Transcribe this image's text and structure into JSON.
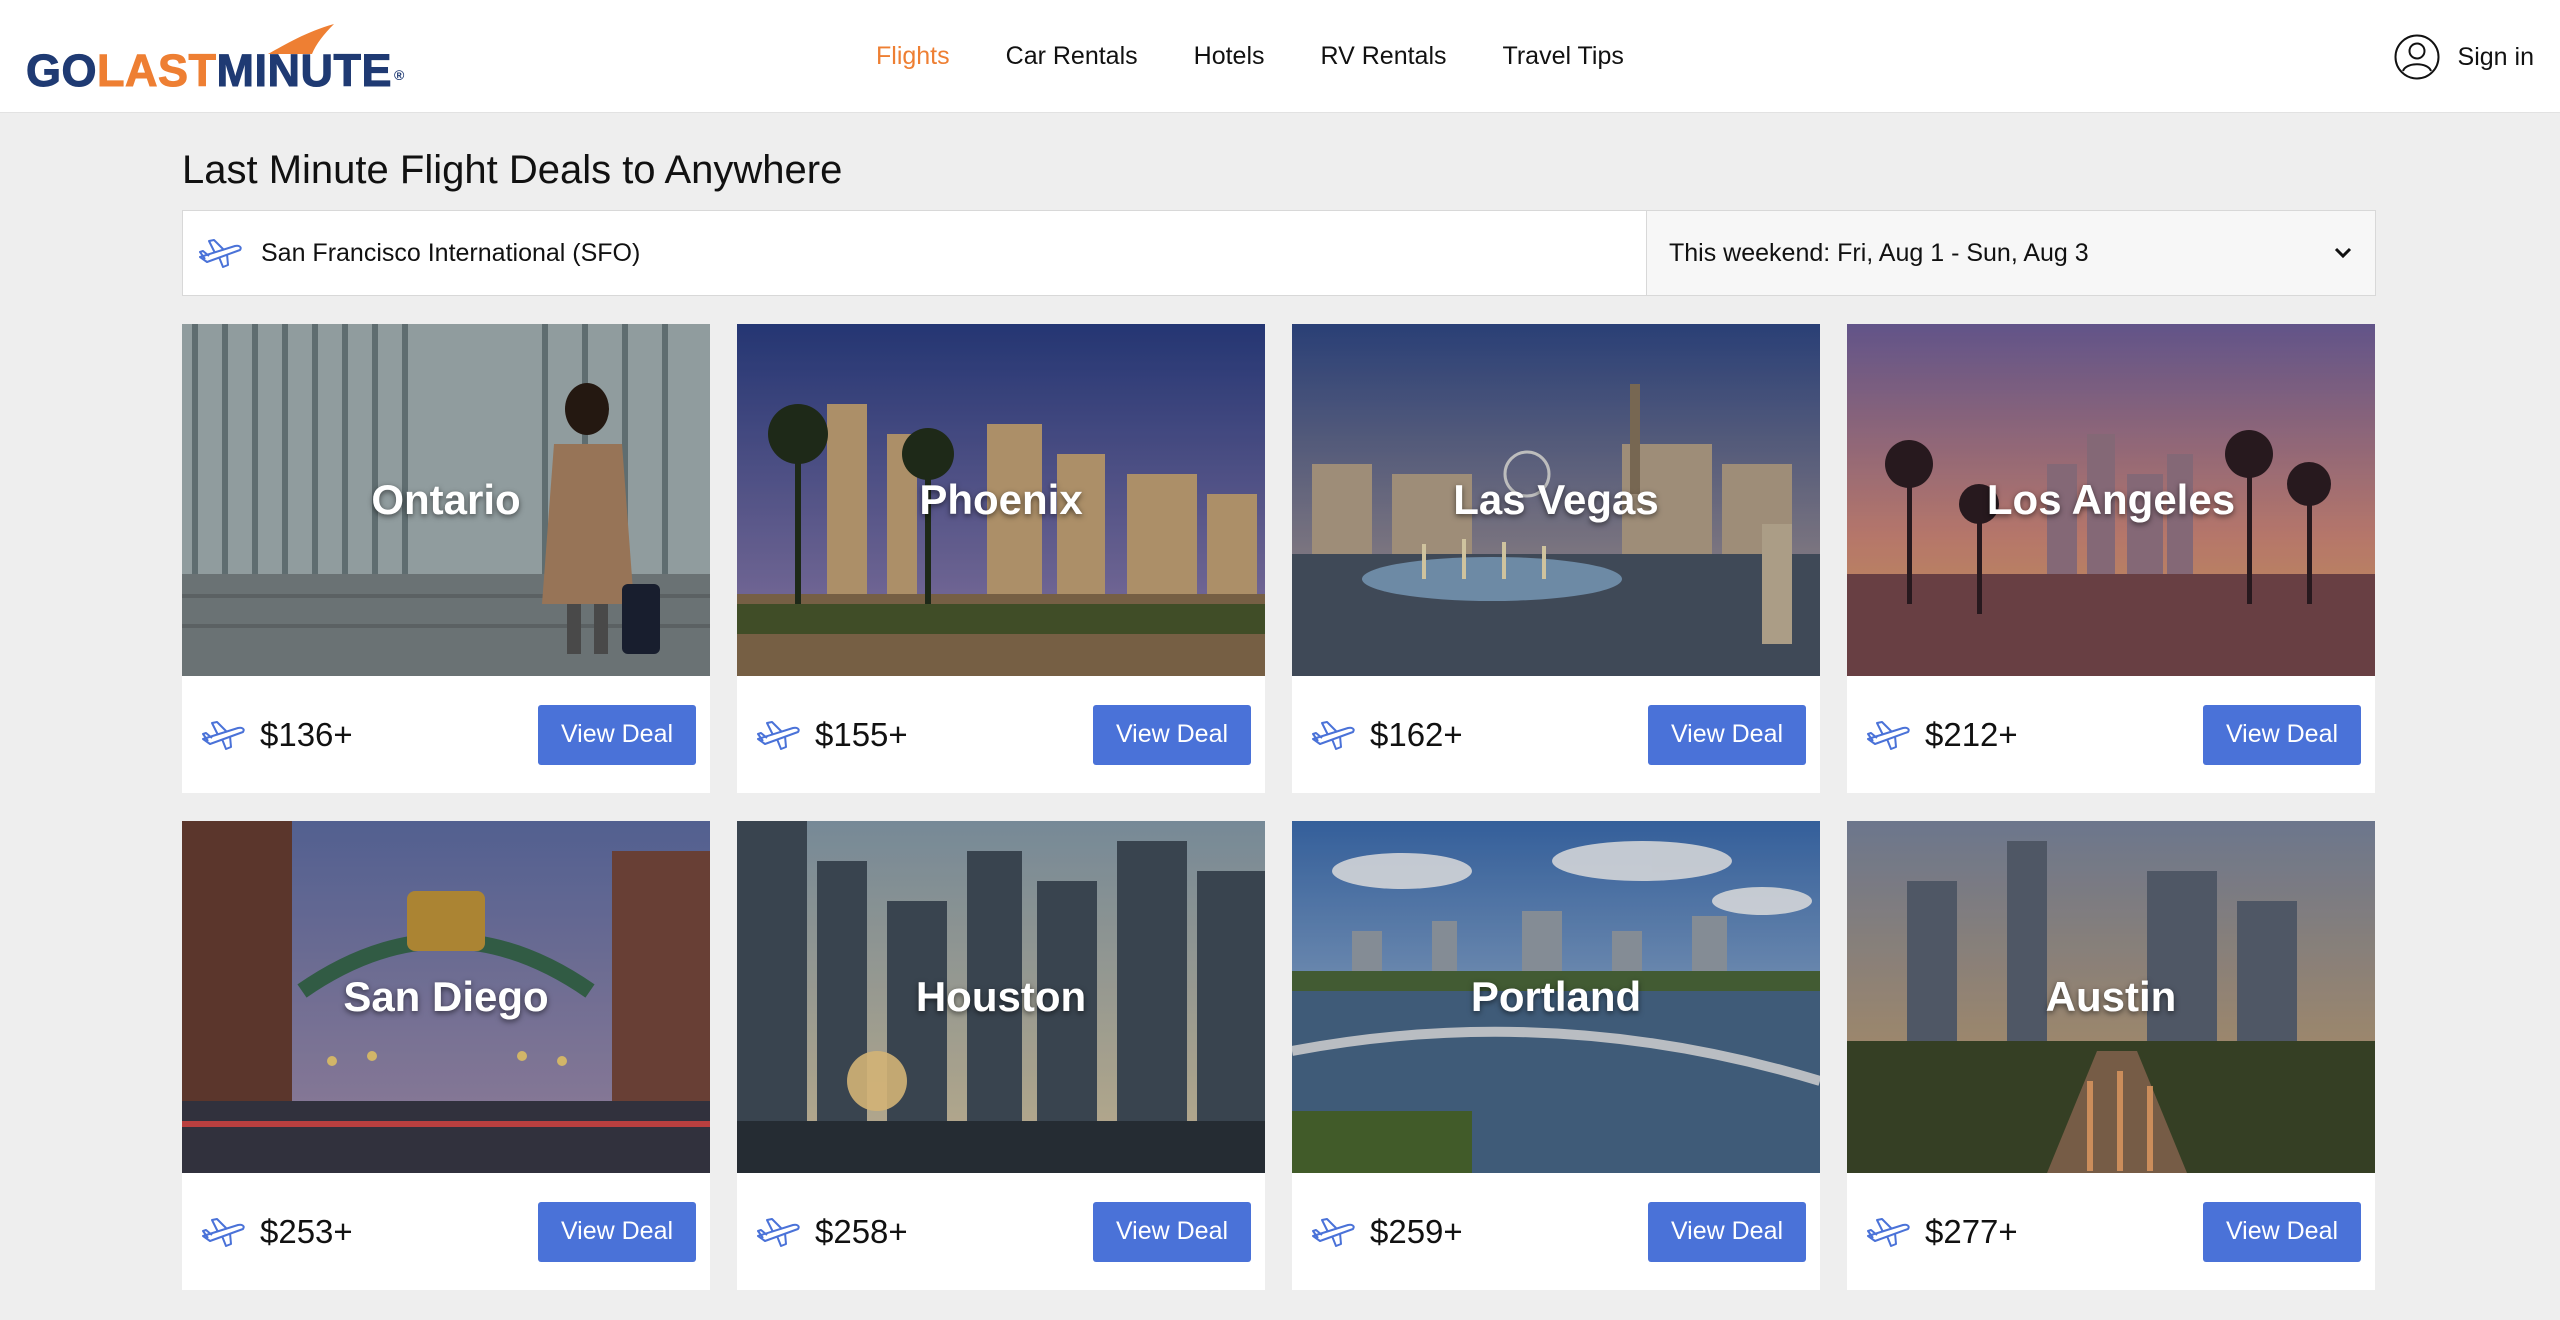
{
  "brand": {
    "logo_go": "GO",
    "logo_last": "LAST",
    "logo_minute": "MINUTE",
    "logo_reg": "®",
    "colors": {
      "navy": "#1f3a73",
      "orange": "#ee7f33"
    }
  },
  "nav": {
    "items": [
      {
        "label": "Flights",
        "active": true
      },
      {
        "label": "Car Rentals",
        "active": false
      },
      {
        "label": "Hotels",
        "active": false
      },
      {
        "label": "RV Rentals",
        "active": false
      },
      {
        "label": "Travel Tips",
        "active": false
      }
    ],
    "signin_label": "Sign in",
    "signin_icon": "user-circle-icon"
  },
  "main": {
    "title": "Last Minute Flight Deals to Anywhere",
    "origin": {
      "icon": "plane-icon",
      "value": "San Francisco International (SFO)"
    },
    "date_range": {
      "selected": "This weekend: Fri, Aug 1 - Sun, Aug 3",
      "icon": "chevron-down-icon"
    }
  },
  "deals": [
    {
      "city": "Ontario",
      "price": "$136+",
      "button": "View Deal",
      "scene": "person-with-luggage"
    },
    {
      "city": "Phoenix",
      "price": "$155+",
      "button": "View Deal",
      "scene": "palm-skyline"
    },
    {
      "city": "Las Vegas",
      "price": "$162+",
      "button": "View Deal",
      "scene": "strip-fountains"
    },
    {
      "city": "Los Angeles",
      "price": "$212+",
      "button": "View Deal",
      "scene": "palms-sunset"
    },
    {
      "city": "San Diego",
      "price": "$253+",
      "button": "View Deal",
      "scene": "gaslamp-arch"
    },
    {
      "city": "Houston",
      "price": "$258+",
      "button": "View Deal",
      "scene": "downtown-towers"
    },
    {
      "city": "Portland",
      "price": "$259+",
      "button": "View Deal",
      "scene": "river-bridge"
    },
    {
      "city": "Austin",
      "price": "$277+",
      "button": "View Deal",
      "scene": "street-skyline"
    }
  ],
  "theme": {
    "button_color": "#4a72d8",
    "page_background": "#eeeeee"
  }
}
